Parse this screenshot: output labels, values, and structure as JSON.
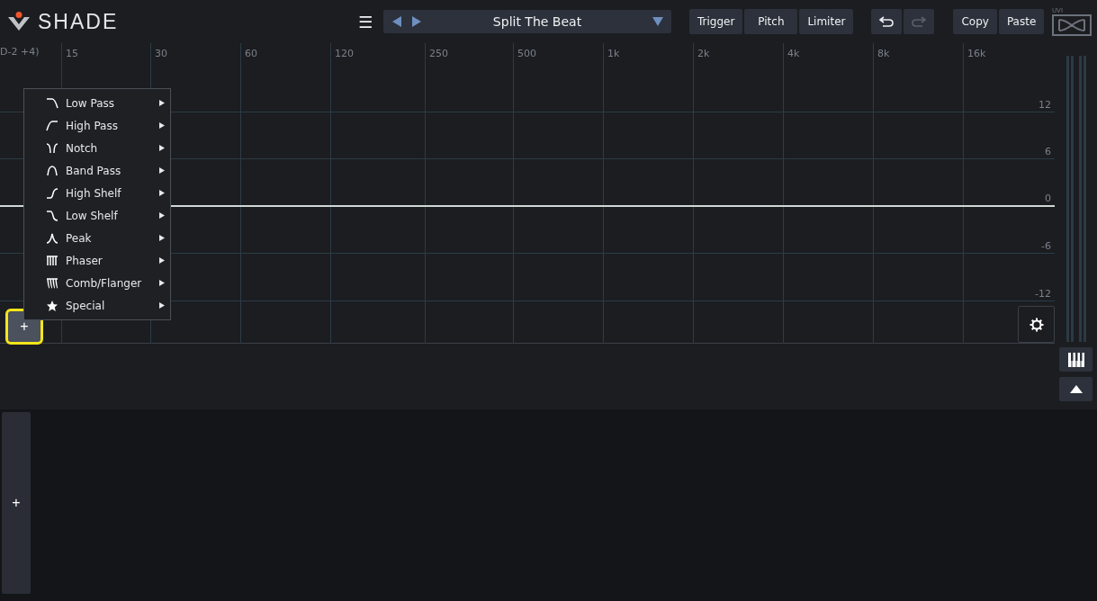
{
  "header": {
    "logo": "SHADE",
    "menu_icon": "☰",
    "preset": {
      "name": "Split The Beat"
    },
    "modules": [
      {
        "label": "Trigger"
      },
      {
        "label": "Pitch"
      },
      {
        "label": "Limiter"
      }
    ],
    "history": [
      {
        "kind": "undo",
        "disabled": false
      },
      {
        "kind": "redo",
        "disabled": true
      }
    ],
    "clipboard": [
      {
        "label": "Copy"
      },
      {
        "label": "Paste"
      }
    ],
    "brand": "UVI"
  },
  "graph": {
    "range_label": "D-2 +4)",
    "freq_labels": [
      "15",
      "30",
      "60",
      "120",
      "250",
      "500",
      "1k",
      "2k",
      "4k",
      "8k",
      "16k"
    ],
    "db_labels": [
      "12",
      "6",
      "0",
      "-6",
      "-12"
    ],
    "add_button": {
      "label": "+",
      "highlighted": true
    }
  },
  "filter_menu": [
    {
      "label": "Low Pass",
      "kind": "lowpass"
    },
    {
      "label": "High Pass",
      "kind": "highpass"
    },
    {
      "label": "Notch",
      "kind": "notch"
    },
    {
      "label": "Band Pass",
      "kind": "bandpass"
    },
    {
      "label": "High Shelf",
      "kind": "highshelf"
    },
    {
      "label": "Low Shelf",
      "kind": "lowshelf"
    },
    {
      "label": "Peak",
      "kind": "peak"
    },
    {
      "label": "Phaser",
      "kind": "phaser"
    },
    {
      "label": "Comb/Flanger",
      "kind": "comb"
    },
    {
      "label": "Special",
      "kind": "special"
    }
  ],
  "bottom_panel": {
    "add_button": {
      "label": "+"
    }
  }
}
